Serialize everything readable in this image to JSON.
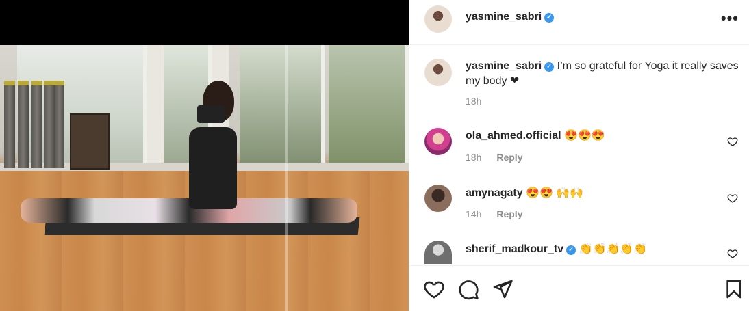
{
  "post": {
    "author": "yasmine_sabri",
    "verified": true
  },
  "header": {
    "username": "yasmine_sabri",
    "more_label": "•••"
  },
  "caption": {
    "username": "yasmine_sabri",
    "text": "I’m so grateful for Yoga it really saves my body ❤",
    "time": "18h"
  },
  "comments": [
    {
      "username": "ola_ahmed.official",
      "text": "😍😍😍",
      "time": "18h",
      "reply_label": "Reply",
      "verified": false
    },
    {
      "username": "amynagaty",
      "text": "😍😍 🙌🙌",
      "time": "14h",
      "reply_label": "Reply",
      "verified": false
    },
    {
      "username": "sherif_madkour_tv",
      "text": "👏👏👏👏👏",
      "time": "",
      "reply_label": "",
      "verified": true
    }
  ],
  "icons": {
    "like": "heart-icon",
    "comment": "comment-icon",
    "share": "send-icon",
    "save": "bookmark-icon",
    "more": "more-options-icon",
    "verified": "verified-badge-icon"
  },
  "colors": {
    "verified": "#3897f0",
    "muted": "#8e8e8e",
    "text": "#262626",
    "border": "#efefef"
  }
}
